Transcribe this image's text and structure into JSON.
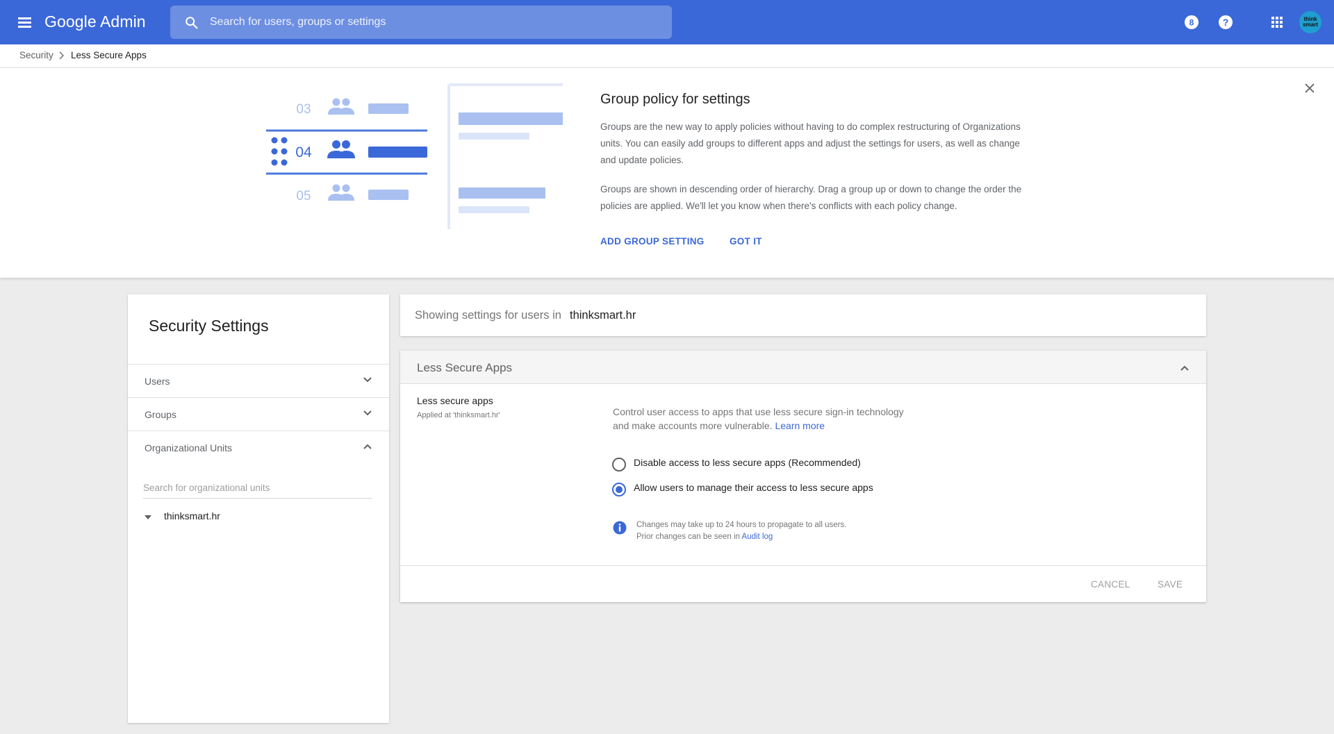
{
  "topbar": {
    "app_title": "Google Admin",
    "search_placeholder": "Search for users, groups or settings",
    "notification_count": "8",
    "avatar_text": "think smart",
    "accent_color": "#3b68d8",
    "icons": [
      "menu-icon",
      "search-icon",
      "notifications-icon",
      "help-icon",
      "apps-grid-icon"
    ]
  },
  "breadcrumb": {
    "parent": "Security",
    "current": "Less Secure Apps"
  },
  "banner": {
    "illustration_numbers": [
      "03",
      "04",
      "05"
    ],
    "title": "Group policy for settings",
    "paragraph1": "Groups are the new way to apply policies without having to do complex restructuring of Organizations units. You can easily add groups to different apps and adjust the settings for users, as well as change and update policies.",
    "paragraph2": "Groups are shown in descending order of hierarchy. Drag a group up or down to change the order the policies are applied. We'll let you know when there's conflicts with each policy change.",
    "add_group_label": "ADD GROUP SETTING",
    "got_it_label": "GOT IT"
  },
  "sidebar": {
    "title": "Security Settings",
    "sections": [
      {
        "label": "Users",
        "expanded": false
      },
      {
        "label": "Groups",
        "expanded": false
      },
      {
        "label": "Organizational Units",
        "expanded": true
      }
    ],
    "ou_search_placeholder": "Search for organizational units",
    "ou_tree": [
      "thinksmart.hr"
    ]
  },
  "main": {
    "showing_prefix": "Showing settings for users in",
    "showing_org": "thinksmart.hr",
    "card": {
      "title": "Less Secure Apps",
      "setting_name": "Less secure apps",
      "applied_at": "Applied at 'thinksmart.hr'",
      "description": "Control user access to apps that use less secure sign-in technology and make accounts more vulnerable.",
      "learn_more": "Learn more",
      "options": [
        {
          "label": "Disable access to less secure apps (Recommended)",
          "selected": false
        },
        {
          "label": "Allow users to manage their access to less secure apps",
          "selected": true
        }
      ],
      "info_line1": "Changes may take up to 24 hours to propagate to all users.",
      "info_line2_prefix": "Prior changes can be seen in",
      "audit_log": "Audit log",
      "cancel_label": "CANCEL",
      "save_label": "SAVE"
    }
  }
}
